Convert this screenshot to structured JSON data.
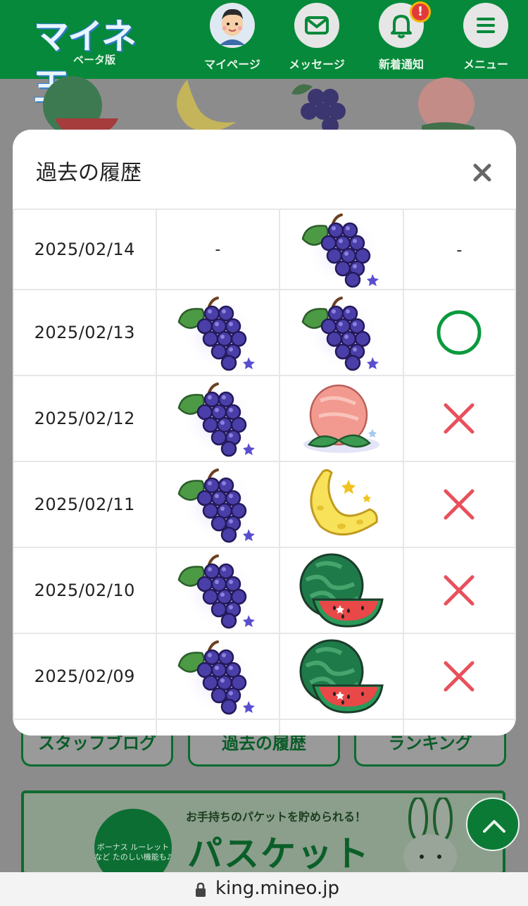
{
  "header": {
    "logo_title": "マイネ王",
    "logo_sub": "ベータ版",
    "nav": [
      {
        "label": "マイページ",
        "icon": "avatar-icon"
      },
      {
        "label": "メッセージ",
        "icon": "mail-icon"
      },
      {
        "label": "新着通知",
        "icon": "bell-icon",
        "badge": "!"
      },
      {
        "label": "メニュー",
        "icon": "menu-icon"
      }
    ]
  },
  "modal": {
    "title": "過去の履歴",
    "close_icon": "close-icon",
    "rows": [
      {
        "date": "2025/02/14",
        "pick": "-",
        "result": "grape",
        "judge": "-"
      },
      {
        "date": "2025/02/13",
        "pick": "grape",
        "result": "grape",
        "judge": "circle"
      },
      {
        "date": "2025/02/12",
        "pick": "grape",
        "result": "peach",
        "judge": "cross"
      },
      {
        "date": "2025/02/11",
        "pick": "grape",
        "result": "banana",
        "judge": "cross"
      },
      {
        "date": "2025/02/10",
        "pick": "grape",
        "result": "watermelon",
        "judge": "cross"
      },
      {
        "date": "2025/02/09",
        "pick": "grape",
        "result": "watermelon",
        "judge": "cross"
      }
    ]
  },
  "background": {
    "buttons": [
      "スタッフブログ",
      "過去の履歴",
      "ランキング"
    ],
    "banner_top": "お手持ちのパケットを貯められる！",
    "banner_title": "パスケット",
    "banner_circle": "ボーナス\nルーレットなど\nたのしい機能も♪"
  },
  "urlbar": {
    "url": "king.mineo.jp"
  },
  "colors": {
    "brand_green": "#06893a",
    "circle_green": "#0a9a3e",
    "cross_red": "#e8505b"
  }
}
